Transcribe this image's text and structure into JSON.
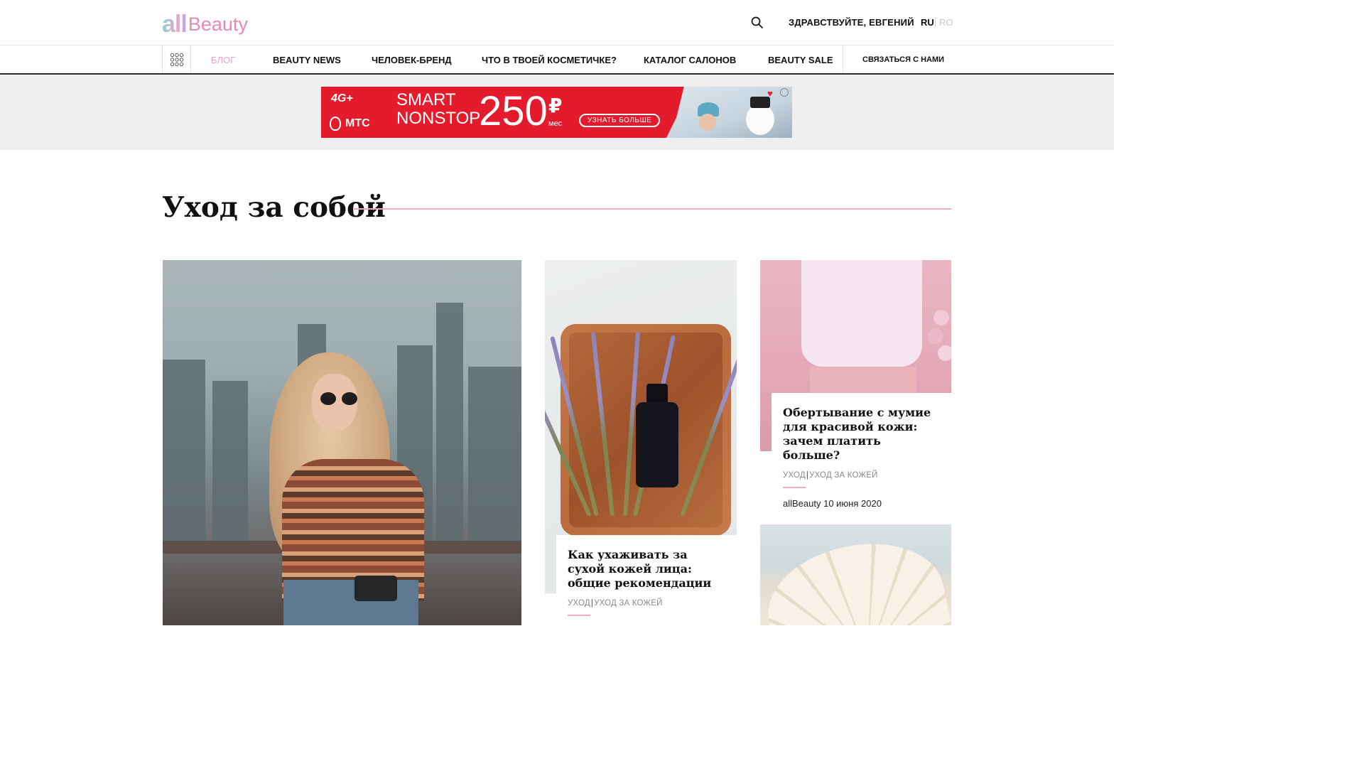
{
  "header": {
    "logo_all": "all",
    "logo_beauty": "Beauty",
    "greeting": "ЗДРАВСТВУЙТЕ, ЕВГЕНИЙ",
    "lang_active": "RU",
    "lang_inactive": "RO"
  },
  "nav": {
    "items": [
      {
        "label": "БЛОГ",
        "active": true
      },
      {
        "label": "BEAUTY NEWS",
        "active": false
      },
      {
        "label": "ЧЕЛОВЕК-БРЕНД",
        "active": false
      },
      {
        "label": "ЧТО В ТВОЕЙ КОСМЕТИЧКЕ?",
        "active": false
      },
      {
        "label": "КАТАЛОГ САЛОНОВ",
        "active": false
      },
      {
        "label": "BEAUTY SALE",
        "active": false
      }
    ],
    "contact": "СВЯЗАТЬСЯ С НАМИ"
  },
  "ad": {
    "network": "4G+",
    "brand": "МТС",
    "line1": "SMART",
    "line2": "NONSTOP",
    "price": "250",
    "currency": "₽",
    "period": "мес",
    "cta": "УЗНАТЬ БОЛЬШЕ"
  },
  "section": {
    "title": "Уход за собой"
  },
  "cards": [
    {
      "title": "Как ухаживать за сухой кожей лица: общие рекомендации",
      "cat1": "УХОД",
      "cat2": "УХОД ЗА КОЖЕЙ"
    },
    {
      "title": "Обертывание с мумие для красивой кожи: зачем платить больше?",
      "cat1": "УХОД",
      "cat2": "УХОД ЗА КОЖЕЙ",
      "meta": "allBeauty 10 июня 2020"
    }
  ],
  "colors": {
    "accent_pink": "#f0a9c9",
    "ad_red": "#e41b2c",
    "nav_active": "#f0a3c4"
  },
  "icons": [
    "search-icon",
    "grid-menu-icon",
    "heart-icon",
    "chat-icon"
  ]
}
